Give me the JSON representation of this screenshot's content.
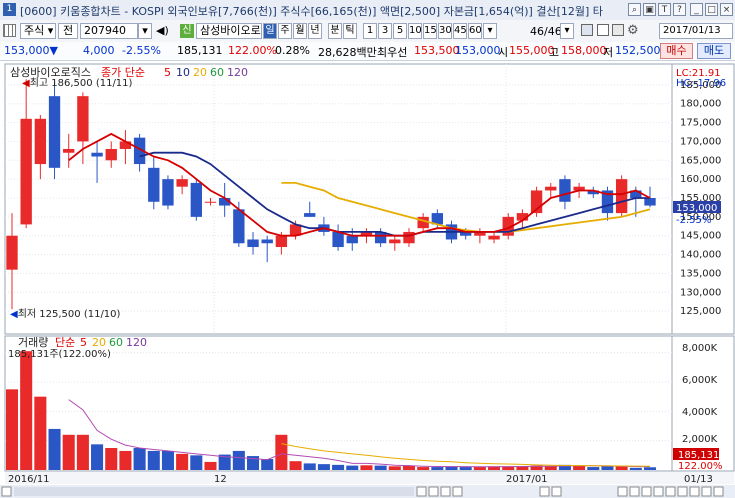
{
  "titlebar": {
    "text": "[0600] 키움종합차트 - KOSPI 외국인보유[7,766(천)] 주식수[66,165(천)] 액면[2,500] 자본금[1,654(억)] 결산[12월] 타",
    "icons": [
      "search-icon",
      "help-icon",
      "text-size-icon",
      "question-icon",
      "minimize-icon",
      "maximize-icon",
      "close-icon"
    ]
  },
  "toolbar": {
    "market": "주식",
    "prev_label": "전",
    "code": "207940",
    "name_badge": "신",
    "name": "삼성바이오로",
    "periods": [
      "일",
      "주",
      "월",
      "년",
      "분",
      "틱"
    ],
    "active_period": "일",
    "minutes": [
      "1",
      "3",
      "5",
      "10",
      "15",
      "30",
      "45",
      "60"
    ],
    "count": "46/46",
    "date": "2017/01/13"
  },
  "quote": {
    "price": "153,000▼",
    "change": "4,000",
    "change_pct": "-2.55%",
    "volume": "185,131",
    "vol_ratio": "122.00%",
    "turnover": "0.28%",
    "amount": "28,628백만",
    "best_ask_label": "최우선",
    "best_ask": "153,500",
    "best_bid": "153,000",
    "open_label": "시",
    "open": "155,000",
    "high_label": "고",
    "high": "158,000",
    "low_label": "저",
    "low": "152,500",
    "buy_label": "매수",
    "sell_label": "매도"
  },
  "price_panel": {
    "legend_name": "삼성바이오로직스",
    "legend_type": "종가 단순",
    "ma_labels": [
      "5",
      "10",
      "20",
      "60",
      "120"
    ],
    "ma_colors": [
      "#e00000",
      "#1a2a8c",
      "#e6ad00",
      "#1e9a3c",
      "#7a3a9a"
    ],
    "lc": "LC:21.91",
    "hc": "HC:-17.96",
    "high_annot": "최고 186,500 (11/11)",
    "low_annot": "최저 125,500 (11/10)",
    "last_price": "153,000",
    "last_pct": "-2.55%"
  },
  "volume_panel": {
    "legend_name": "거래량",
    "legend_type": "단순",
    "ma_labels": [
      "5",
      "20",
      "60",
      "120"
    ],
    "ma_colors": [
      "#e00000",
      "#e6ad00",
      "#1e9a3c",
      "#7a3a9a"
    ],
    "current": "185,131주(122.00%)",
    "last_volume": "185,131",
    "last_pct": "122.00%",
    "yticks": [
      "8,000K",
      "6,000K",
      "4,000K",
      "2,000K"
    ]
  },
  "xaxis": {
    "labels": [
      "2016/11",
      "12",
      "2017/01",
      "01/13"
    ]
  },
  "chart_data": {
    "type": "candlestick",
    "ylim": [
      120000,
      190000
    ],
    "yticks": [
      125000,
      130000,
      135000,
      140000,
      145000,
      150000,
      155000,
      160000,
      165000,
      170000,
      175000,
      180000,
      185000
    ],
    "candles": [
      {
        "o": 136000,
        "h": 151000,
        "l": 125500,
        "c": 145000,
        "v": 5500
      },
      {
        "o": 148000,
        "h": 186500,
        "l": 147000,
        "c": 176000,
        "v": 8100
      },
      {
        "o": 164000,
        "h": 177000,
        "l": 160000,
        "c": 176000,
        "v": 5000
      },
      {
        "o": 182000,
        "h": 186000,
        "l": 160000,
        "c": 163000,
        "v": 2800
      },
      {
        "o": 167000,
        "h": 172000,
        "l": 163000,
        "c": 168000,
        "v": 2400
      },
      {
        "o": 170000,
        "h": 183000,
        "l": 164000,
        "c": 182000,
        "v": 2400
      },
      {
        "o": 167000,
        "h": 170000,
        "l": 159000,
        "c": 166000,
        "v": 1750
      },
      {
        "o": 165000,
        "h": 170000,
        "l": 163000,
        "c": 168000,
        "v": 1500
      },
      {
        "o": 168000,
        "h": 173000,
        "l": 164000,
        "c": 170000,
        "v": 1300
      },
      {
        "o": 171000,
        "h": 172000,
        "l": 162000,
        "c": 164000,
        "v": 1500
      },
      {
        "o": 163000,
        "h": 166000,
        "l": 152000,
        "c": 154000,
        "v": 1300
      },
      {
        "o": 160000,
        "h": 161000,
        "l": 152000,
        "c": 153000,
        "v": 1300
      },
      {
        "o": 158000,
        "h": 161000,
        "l": 156000,
        "c": 160000,
        "v": 1100
      },
      {
        "o": 159000,
        "h": 160000,
        "l": 149000,
        "c": 150000,
        "v": 1000
      },
      {
        "o": 154000,
        "h": 155000,
        "l": 153000,
        "c": 154000,
        "v": 550
      },
      {
        "o": 155000,
        "h": 159000,
        "l": 150000,
        "c": 153000,
        "v": 1050
      },
      {
        "o": 152000,
        "h": 154000,
        "l": 142000,
        "c": 143000,
        "v": 1300
      },
      {
        "o": 144000,
        "h": 146000,
        "l": 140000,
        "c": 142000,
        "v": 950
      },
      {
        "o": 144000,
        "h": 145000,
        "l": 138000,
        "c": 143000,
        "v": 750
      },
      {
        "o": 142000,
        "h": 146000,
        "l": 140000,
        "c": 145000,
        "v": 2400
      },
      {
        "o": 145000,
        "h": 149000,
        "l": 144000,
        "c": 148000,
        "v": 600
      },
      {
        "o": 151000,
        "h": 154000,
        "l": 150000,
        "c": 150000,
        "v": 450
      },
      {
        "o": 148000,
        "h": 150000,
        "l": 145000,
        "c": 146000,
        "v": 400
      },
      {
        "o": 146000,
        "h": 148000,
        "l": 141000,
        "c": 142000,
        "v": 350
      },
      {
        "o": 145000,
        "h": 147000,
        "l": 141000,
        "c": 143000,
        "v": 300
      },
      {
        "o": 145000,
        "h": 147000,
        "l": 143000,
        "c": 146000,
        "v": 320
      },
      {
        "o": 146000,
        "h": 147000,
        "l": 142000,
        "c": 143000,
        "v": 300
      },
      {
        "o": 143000,
        "h": 145000,
        "l": 141000,
        "c": 144000,
        "v": 250
      },
      {
        "o": 143000,
        "h": 147000,
        "l": 142000,
        "c": 146000,
        "v": 300
      },
      {
        "o": 147000,
        "h": 151000,
        "l": 146000,
        "c": 150000,
        "v": 200
      },
      {
        "o": 151000,
        "h": 152000,
        "l": 147000,
        "c": 148000,
        "v": 200
      },
      {
        "o": 148000,
        "h": 149000,
        "l": 143000,
        "c": 144000,
        "v": 250
      },
      {
        "o": 146000,
        "h": 147000,
        "l": 144000,
        "c": 145000,
        "v": 200
      },
      {
        "o": 145000,
        "h": 147000,
        "l": 143000,
        "c": 146000,
        "v": 200
      },
      {
        "o": 144000,
        "h": 146000,
        "l": 143000,
        "c": 145000,
        "v": 250
      },
      {
        "o": 145000,
        "h": 151000,
        "l": 144000,
        "c": 150000,
        "v": 250
      },
      {
        "o": 149000,
        "h": 152000,
        "l": 147000,
        "c": 151000,
        "v": 250
      },
      {
        "o": 151000,
        "h": 158000,
        "l": 150000,
        "c": 157000,
        "v": 300
      },
      {
        "o": 157000,
        "h": 159000,
        "l": 155000,
        "c": 158000,
        "v": 250
      },
      {
        "o": 160000,
        "h": 161000,
        "l": 152000,
        "c": 154000,
        "v": 350
      },
      {
        "o": 157000,
        "h": 159000,
        "l": 155000,
        "c": 158000,
        "v": 300
      },
      {
        "o": 157000,
        "h": 158000,
        "l": 155000,
        "c": 156000,
        "v": 200
      },
      {
        "o": 157000,
        "h": 158000,
        "l": 149000,
        "c": 151000,
        "v": 300
      },
      {
        "o": 151000,
        "h": 161000,
        "l": 150000,
        "c": 160000,
        "v": 300
      },
      {
        "o": 157000,
        "h": 158000,
        "l": 150000,
        "c": 155000,
        "v": 150
      },
      {
        "o": 155000,
        "h": 158000,
        "l": 152500,
        "c": 153000,
        "v": 185
      }
    ],
    "ma5": [
      null,
      null,
      null,
      null,
      165000,
      168000,
      170000,
      172000,
      170000,
      168000,
      166000,
      165000,
      163000,
      160000,
      157000,
      155000,
      152000,
      149000,
      146000,
      145000,
      145000,
      146000,
      147000,
      146000,
      145000,
      145000,
      145000,
      145000,
      145000,
      146000,
      147000,
      147000,
      146000,
      146000,
      146000,
      147000,
      149000,
      152000,
      155000,
      156000,
      157000,
      157000,
      156000,
      156000,
      157000,
      155000
    ],
    "ma10": [
      null,
      null,
      null,
      null,
      null,
      null,
      null,
      null,
      null,
      166000,
      167000,
      167000,
      167000,
      166000,
      164000,
      161000,
      158000,
      155000,
      152000,
      150000,
      148000,
      147000,
      147000,
      146000,
      146000,
      146000,
      146000,
      145000,
      145000,
      146000,
      146000,
      146000,
      146000,
      146000,
      146000,
      146000,
      147000,
      148000,
      149000,
      150000,
      151000,
      152000,
      153000,
      154000,
      155000,
      155000
    ],
    "ma20": [
      null,
      null,
      null,
      null,
      null,
      null,
      null,
      null,
      null,
      null,
      null,
      null,
      null,
      null,
      null,
      null,
      null,
      null,
      null,
      159000,
      159000,
      158000,
      157000,
      155000,
      154000,
      153000,
      152000,
      151000,
      150000,
      149000,
      148000,
      147000,
      146500,
      146000,
      146000,
      146000,
      146500,
      147000,
      147500,
      148000,
      148500,
      149000,
      149500,
      150000,
      151000,
      152000
    ],
    "ma60": [],
    "ma120": [],
    "vol_ylim": [
      0,
      9000
    ],
    "vol_ma5": [
      null,
      null,
      null,
      null,
      4800,
      4100,
      2700,
      2100,
      1700,
      1500,
      1400,
      1300,
      1200,
      1100,
      1000,
      900,
      850,
      780,
      700,
      1100,
      1000,
      900,
      800,
      650,
      450,
      450,
      400,
      320,
      300,
      260,
      240,
      230,
      230,
      220,
      220,
      230,
      240,
      250,
      260,
      280,
      290,
      290,
      280,
      260,
      240,
      220
    ],
    "vol_ma20": [
      null,
      null,
      null,
      null,
      null,
      null,
      null,
      null,
      null,
      null,
      null,
      null,
      null,
      null,
      null,
      null,
      null,
      null,
      null,
      1800,
      1600,
      1450,
      1300,
      1200,
      1100,
      1000,
      900,
      800,
      720,
      650,
      600,
      560,
      500,
      460,
      430,
      410,
      380,
      350,
      330,
      310,
      300,
      290,
      280,
      270,
      265,
      260
    ]
  }
}
